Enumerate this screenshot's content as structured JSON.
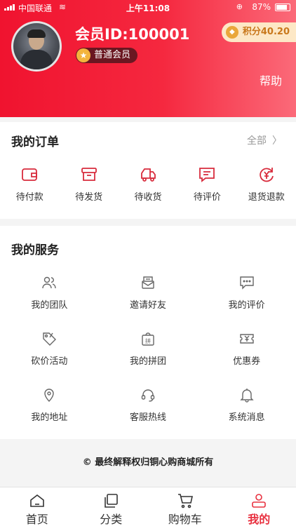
{
  "status_bar": {
    "carrier": "中国联通",
    "time": "上午11:08",
    "battery": "87%"
  },
  "profile": {
    "member_id": "会员ID:100001",
    "level": "普通会员",
    "points": "积分40.20",
    "help": "帮助"
  },
  "orders": {
    "title": "我的订单",
    "all": "全部",
    "items": [
      {
        "label": "待付款",
        "icon": "wallet-icon"
      },
      {
        "label": "待发货",
        "icon": "box-icon"
      },
      {
        "label": "待收货",
        "icon": "truck-icon"
      },
      {
        "label": "待评价",
        "icon": "comment-icon"
      },
      {
        "label": "退货退款",
        "icon": "refund-icon"
      }
    ]
  },
  "services": {
    "title": "我的服务",
    "items": [
      {
        "label": "我的团队",
        "icon": "team-icon"
      },
      {
        "label": "邀请好友",
        "icon": "invite-icon"
      },
      {
        "label": "我的评价",
        "icon": "review-icon"
      },
      {
        "label": "砍价活动",
        "icon": "bargain-icon"
      },
      {
        "label": "我的拼团",
        "icon": "group-buy-icon"
      },
      {
        "label": "优惠券",
        "icon": "coupon-icon"
      },
      {
        "label": "我的地址",
        "icon": "location-icon"
      },
      {
        "label": "客服热线",
        "icon": "headset-icon"
      },
      {
        "label": "系统消息",
        "icon": "bell-icon"
      }
    ]
  },
  "footer": "© 最终解释权归铜心购商城所有",
  "tabbar": {
    "items": [
      {
        "label": "首页",
        "icon": "home-icon",
        "active": false
      },
      {
        "label": "分类",
        "icon": "category-icon",
        "active": false
      },
      {
        "label": "购物车",
        "icon": "cart-icon",
        "active": false
      },
      {
        "label": "我的",
        "icon": "user-icon",
        "active": true
      }
    ]
  },
  "colors": {
    "accent": "#e8303f",
    "header_start": "#f0132f",
    "header_end": "#fb6a79"
  }
}
